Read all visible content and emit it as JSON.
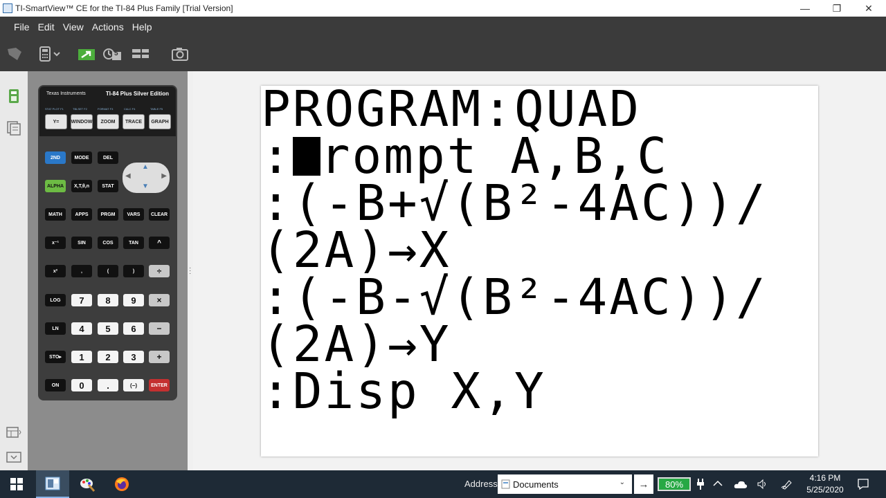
{
  "window": {
    "title": "TI-SmartView™ CE for the TI-84 Plus Family [Trial Version]",
    "minimize": "—",
    "restore": "❐",
    "close": "✕"
  },
  "menu": [
    "File",
    "Edit",
    "View",
    "Actions",
    "Help"
  ],
  "toolbar": {
    "icons": [
      "ti-logo-icon",
      "calculator-dropdown-icon",
      "send-to-calculator-icon",
      "history-icon",
      "layout-icon",
      "camera-icon"
    ],
    "history_badge": "5"
  },
  "sidebar": {
    "icons": [
      "calculator-view-icon",
      "documents-view-icon",
      "panel-toggle-icon",
      "panel-expand-icon"
    ]
  },
  "calculator": {
    "brand": "Texas Instruments",
    "model": "TI-84 Plus Silver Edition",
    "func_keys": [
      "Y=",
      "WINDOW",
      "ZOOM",
      "TRACE",
      "GRAPH"
    ],
    "func_labels": [
      "STAT PLOT F1",
      "TBLSET F2",
      "FORMAT F3",
      "CALC F4",
      "TABLE F5"
    ],
    "row1": [
      "2ND",
      "MODE",
      "DEL"
    ],
    "row2": [
      "ALPHA",
      "X,T,θ,n",
      "STAT"
    ],
    "row3": [
      "MATH",
      "APPS",
      "PRGM",
      "VARS",
      "CLEAR"
    ],
    "row4": [
      "x⁻¹",
      "SIN",
      "COS",
      "TAN",
      "^"
    ],
    "row5": [
      "x²",
      ",",
      "(",
      ")",
      "÷"
    ],
    "row6": [
      "LOG",
      "7",
      "8",
      "9",
      "×"
    ],
    "row7": [
      "LN",
      "4",
      "5",
      "6",
      "−"
    ],
    "row8": [
      "STO▸",
      "1",
      "2",
      "3",
      "+"
    ],
    "row9": [
      "ON",
      "0",
      ".",
      "(−)",
      "ENTER"
    ]
  },
  "screen": {
    "lines": [
      "PROGRAM:QUAD",
      ":",
      "rompt A,B,C",
      ":(-B+√(B²-4AC))/",
      "(2A)→X",
      ":(-B-√(B²-4AC))/",
      "(2A)→Y",
      ":Disp X,Y"
    ]
  },
  "taskbar": {
    "address_label": "Address",
    "address_value": "Documents",
    "battery": "80%",
    "time": "4:16 PM",
    "date": "5/25/2020",
    "apps": [
      "windows-start-icon",
      "ti-smartview-taskbar-icon",
      "paint-taskbar-icon",
      "firefox-taskbar-icon"
    ]
  }
}
